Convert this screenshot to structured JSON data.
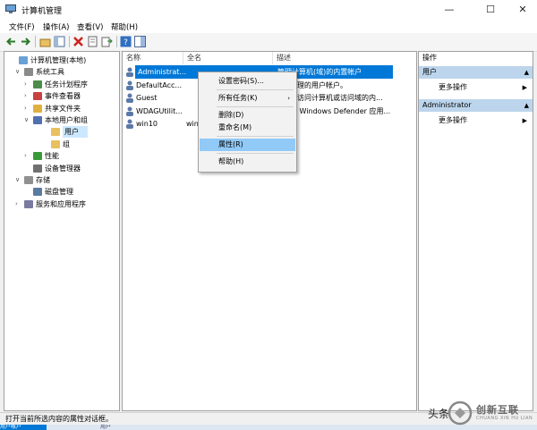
{
  "window": {
    "title": "计算机管理"
  },
  "menubar": [
    "文件(F)",
    "操作(A)",
    "查看(V)",
    "帮助(H)"
  ],
  "tree": [
    {
      "label": "计算机管理(本地)",
      "level": 0,
      "exp": "",
      "icon": "computer-icon"
    },
    {
      "label": "系统工具",
      "level": 1,
      "exp": "∨",
      "icon": "tools-icon"
    },
    {
      "label": "任务计划程序",
      "level": 2,
      "exp": "›",
      "icon": "clock-icon"
    },
    {
      "label": "事件查看器",
      "level": 2,
      "exp": "›",
      "icon": "event-icon"
    },
    {
      "label": "共享文件夹",
      "level": 2,
      "exp": "›",
      "icon": "folder-share-icon"
    },
    {
      "label": "本地用户和组",
      "level": 2,
      "exp": "∨",
      "icon": "users-icon"
    },
    {
      "label": "用户",
      "level": 3,
      "exp": "",
      "icon": "folder-icon",
      "selected": true
    },
    {
      "label": "组",
      "level": 3,
      "exp": "",
      "icon": "folder-icon"
    },
    {
      "label": "性能",
      "level": 2,
      "exp": "›",
      "icon": "performance-icon"
    },
    {
      "label": "设备管理器",
      "level": 2,
      "exp": "",
      "icon": "device-icon"
    },
    {
      "label": "存储",
      "level": 1,
      "exp": "∨",
      "icon": "storage-icon"
    },
    {
      "label": "磁盘管理",
      "level": 2,
      "exp": "",
      "icon": "disk-icon"
    },
    {
      "label": "服务和应用程序",
      "level": 1,
      "exp": "›",
      "icon": "services-icon"
    }
  ],
  "list": {
    "columns": [
      "名称",
      "全名",
      "描述"
    ],
    "rows": [
      {
        "name": "Administrat...",
        "fullname": "",
        "desc": "管理计算机(域)的内置帐户",
        "selected": true
      },
      {
        "name": "DefaultAcc...",
        "fullname": "",
        "desc": "系统管理的用户帐户。"
      },
      {
        "name": "Guest",
        "fullname": "",
        "desc": "供来宾访问计算机或访问域的内..."
      },
      {
        "name": "WDAGUtilit...",
        "fullname": "",
        "desc": "系统为 Windows Defender 应用..."
      },
      {
        "name": "win10",
        "fullname": "win",
        "desc": ""
      }
    ]
  },
  "context_menu": [
    {
      "label": "设置密码(S)...",
      "sub": false
    },
    {
      "sep": true
    },
    {
      "label": "所有任务(K)",
      "sub": true
    },
    {
      "sep": true
    },
    {
      "label": "删除(D)",
      "sub": false
    },
    {
      "label": "重命名(M)",
      "sub": false
    },
    {
      "sep": true
    },
    {
      "label": "属性(R)",
      "sub": false,
      "active": true
    },
    {
      "sep": true
    },
    {
      "label": "帮助(H)",
      "sub": false
    }
  ],
  "actions": {
    "header": "操作",
    "sections": [
      {
        "title": "用户",
        "item": "更多操作"
      },
      {
        "title": "Administrator",
        "item": "更多操作"
      }
    ]
  },
  "status": "打开当前所选内容的属性对话框。",
  "taskbar": [
    "用户帐户",
    "用户"
  ],
  "watermark": {
    "prefix": "头条",
    "brand": "创新互联",
    "sub": "CHUANG XIN HU LIAN"
  },
  "colors": {
    "selection": "#0078d7",
    "menu_highlight": "#91c9f7",
    "action_section": "#bcd5ec"
  }
}
